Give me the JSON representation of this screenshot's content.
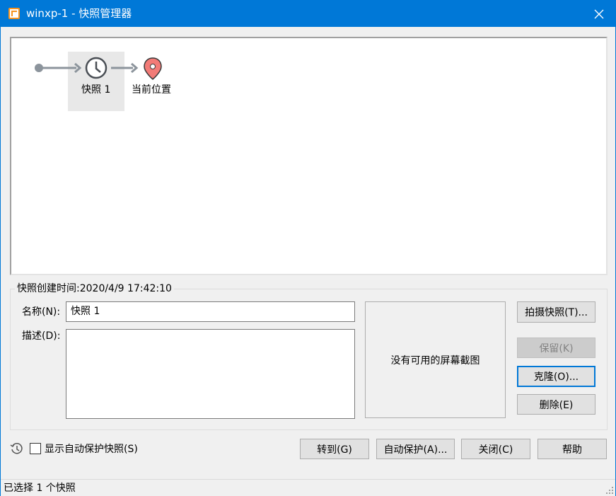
{
  "window": {
    "title": "winxp-1 - 快照管理器",
    "accent_color": "#0078d7"
  },
  "tree": {
    "nodes": [
      {
        "label": "快照 1",
        "icon": "clock-icon",
        "selected": true
      },
      {
        "label": "当前位置",
        "icon": "location-pin-icon",
        "color": "#f27b77"
      }
    ]
  },
  "details": {
    "created_label": "快照创建时间:2020/4/9 17:42:10",
    "name_label": "名称(N):",
    "name_value": "快照 1",
    "desc_label": "描述(D):",
    "desc_value": "",
    "preview_text": "没有可用的屏幕截图"
  },
  "side_buttons": {
    "take_snapshot": "拍摄快照(T)...",
    "keep": "保留(K)",
    "clone": "克隆(O)...",
    "delete": "删除(E)"
  },
  "footer": {
    "show_autoprotect_label": "显示自动保护快照(S)",
    "show_autoprotect_checked": false,
    "goto": "转到(G)",
    "autoprotect": "自动保护(A)...",
    "close": "关闭(C)",
    "help": "帮助"
  },
  "status": {
    "text": "已选择 1 个快照"
  }
}
